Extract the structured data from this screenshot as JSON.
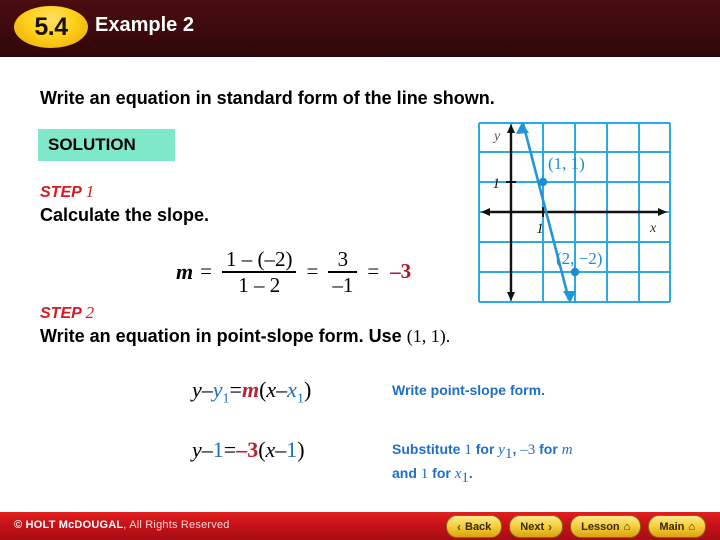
{
  "header": {
    "lesson_number": "5.4",
    "example_title": "Example 2"
  },
  "content": {
    "question": "Write an equation in standard form of the line shown.",
    "solution_label": "SOLUTION",
    "step1": {
      "label": "STEP",
      "number": "1",
      "body": "Calculate the slope."
    },
    "step2": {
      "label": "STEP",
      "number": "2",
      "body": "Write an equation in point-slope form. Use",
      "point": "(1, 1)."
    },
    "slope_equation": {
      "variable": "m",
      "equals": "=",
      "fraction1_numerator": "1 – (–2)",
      "fraction1_denominator": "1 – 2",
      "fraction2_numerator": "3",
      "fraction2_denominator": "–1",
      "result": "–3"
    },
    "equation_generic": {
      "y": "y",
      "minus1": "–",
      "y_sub": "y",
      "y_sub_index": "1",
      "equals": "=",
      "m": "m",
      "open_paren": "(",
      "x": "x",
      "minus2": "–",
      "x_sub": "x",
      "x_sub_index": "1",
      "close_paren": ")"
    },
    "equation_substituted": {
      "y": "y",
      "minus1": "–",
      "value1": "1",
      "equals": "=",
      "slope": "–3",
      "open_paren": "(",
      "x": "x",
      "minus2": "–",
      "value2": "1",
      "close_paren": ")"
    },
    "annotation1": "Write point-slope form.",
    "annotation2": {
      "part1": "Substitute",
      "value1": "1",
      "part2": "for",
      "var1": "y",
      "var1_sub": "1",
      "comma": ",",
      "value2": "–3",
      "part3": "for",
      "var2": "m",
      "line2_part1": "and",
      "value3": "1",
      "line2_part2": "for",
      "var3": "x",
      "var3_sub": "1",
      "period": "."
    }
  },
  "chart_data": {
    "type": "scatter",
    "title": "",
    "xlabel": "x",
    "ylabel": "y",
    "grid": true,
    "xlim": [
      -2,
      4
    ],
    "ylim": [
      -4,
      2
    ],
    "x_tick_label": "1",
    "y_tick_label": "1",
    "points": [
      {
        "label": "(1, 1)",
        "x": 1,
        "y": 1
      },
      {
        "label": "(2, –2)",
        "x": 2,
        "y": -2
      }
    ],
    "line": {
      "slope": -3,
      "through": [
        1,
        1
      ],
      "color": "#2196d6"
    },
    "grid_color": "#29abe2",
    "axis_color": "#000000"
  },
  "footer": {
    "copyright_mark": "© HOLT McDOUGAL",
    "rights": ", All Rights Reserved",
    "nav": [
      {
        "label": "Back",
        "icon": "chevron-left-icon",
        "glyph": "‹"
      },
      {
        "label": "Next",
        "icon": "chevron-right-icon",
        "glyph": "›"
      },
      {
        "label": "Lesson",
        "icon": "home-icon",
        "glyph": "⌂"
      },
      {
        "label": "Main",
        "icon": "home-icon",
        "glyph": "⌂"
      }
    ]
  },
  "colors": {
    "header_bg": "#3d0a0d",
    "badge_yellow": "#ffd21e",
    "solution_bg": "#7fe8c8",
    "step_red": "#d71920",
    "accent_blue": "#1f6fc4",
    "grid_blue": "#29abe2",
    "footer_red": "#c41018"
  }
}
